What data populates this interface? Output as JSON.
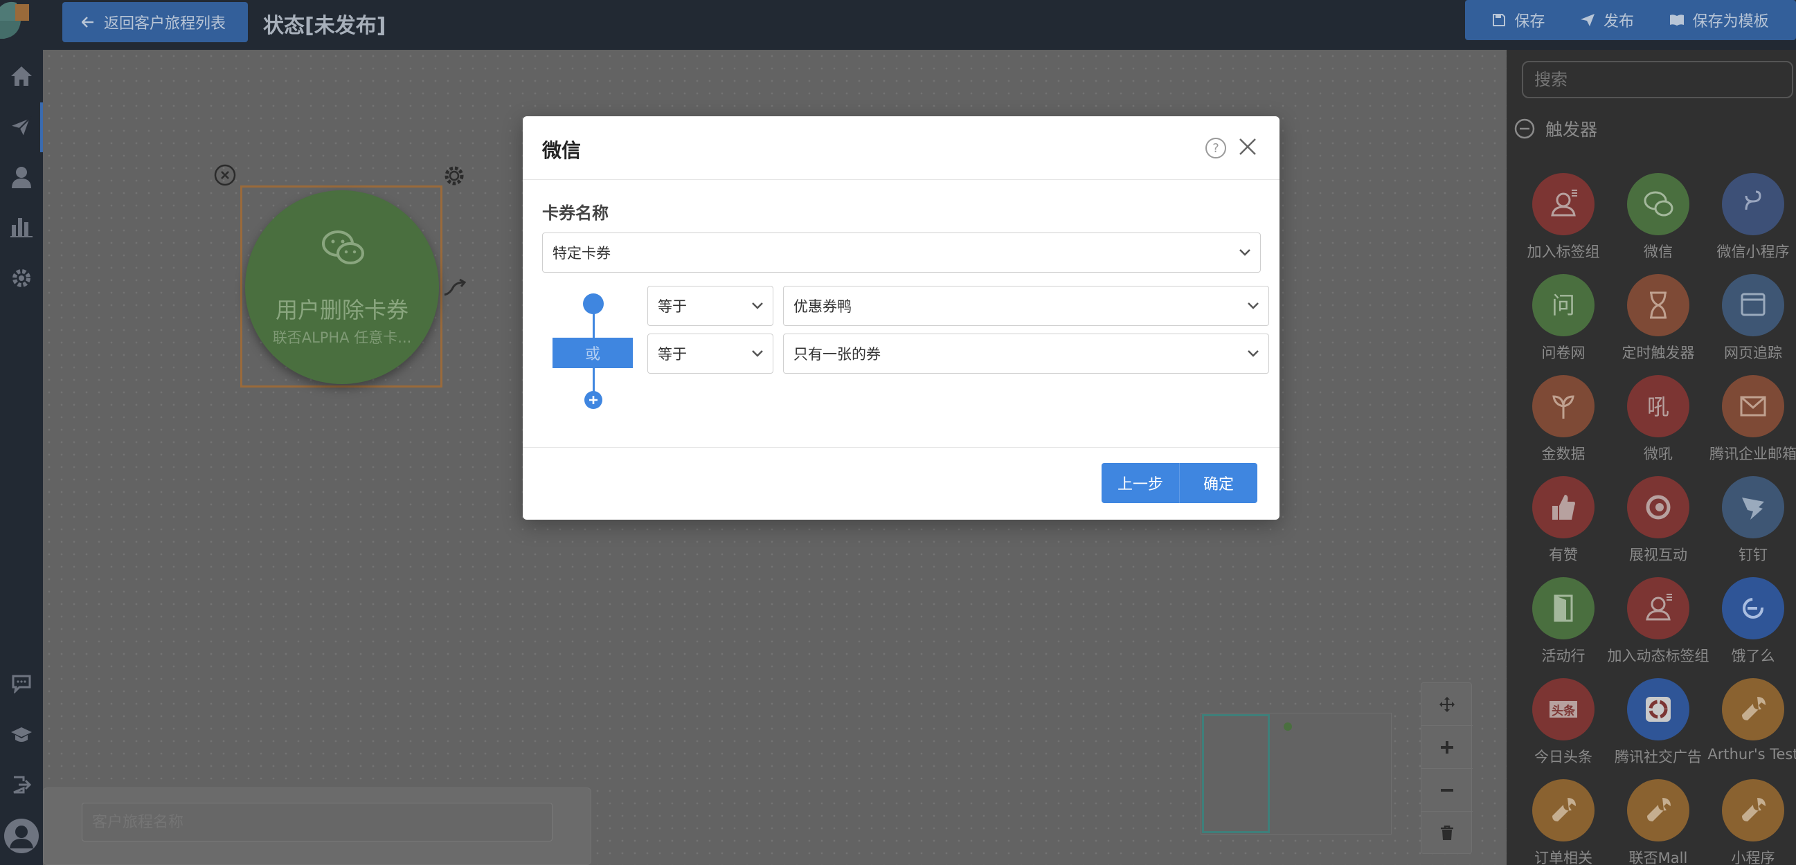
{
  "topbar": {
    "back_label": "返回客户旅程列表",
    "status_title": "状态[未发布]",
    "save_label": "保存",
    "publish_label": "发布",
    "save_template_label": "保存为模板"
  },
  "canvas": {
    "node_title": "用户删除卡券",
    "node_subtitle": "联否ALPHA 任意卡...",
    "journey_name_placeholder": "客户旅程名称"
  },
  "right_panel": {
    "search_placeholder": "搜索",
    "section_title": "触发器",
    "tiles": [
      {
        "label": "加入标签组",
        "color": "#7c3533",
        "icon": "user-tag-icon"
      },
      {
        "label": "微信",
        "color": "#4a6f3f",
        "icon": "wechat-icon"
      },
      {
        "label": "微信小程序",
        "color": "#3d5077",
        "icon": "mini-program-icon"
      },
      {
        "label": "问卷网",
        "color": "#4a6f3f",
        "icon": "wen-icon"
      },
      {
        "label": "定时触发器",
        "color": "#7e4a36",
        "icon": "hourglass-icon"
      },
      {
        "label": "网页追踪",
        "color": "#3e5674",
        "icon": "browser-icon"
      },
      {
        "label": "金数据",
        "color": "#7e4a36",
        "icon": "sprout-icon"
      },
      {
        "label": "微吼",
        "color": "#7c3533",
        "icon": "vhall-icon"
      },
      {
        "label": "腾讯企业邮箱",
        "color": "#7e4a36",
        "icon": "mail-icon"
      },
      {
        "label": "有赞",
        "color": "#7c3533",
        "icon": "thumbs-up-icon"
      },
      {
        "label": "展视互动",
        "color": "#7c3533",
        "icon": "swirl-icon"
      },
      {
        "label": "钉钉",
        "color": "#3e5674",
        "icon": "dingtalk-icon"
      },
      {
        "label": "活动行",
        "color": "#4a6f3f",
        "icon": "door-icon"
      },
      {
        "label": "加入动态标签组",
        "color": "#7c3533",
        "icon": "user-tag-icon"
      },
      {
        "label": "饿了么",
        "color": "#2f5597",
        "icon": "eleme-icon"
      },
      {
        "label": "今日头条",
        "color": "#7c3533",
        "icon": "toutiao-icon"
      },
      {
        "label": "腾讯社交广告",
        "color": "#2f5597",
        "icon": "tencent-ads-icon"
      },
      {
        "label": "Arthur's Test",
        "color": "#8a6230",
        "icon": "wrench-icon"
      },
      {
        "label": "订单相关",
        "color": "#8a6230",
        "icon": "wrench-icon"
      },
      {
        "label": "联否Mall",
        "color": "#8a6230",
        "icon": "wrench-icon"
      },
      {
        "label": "小程序",
        "color": "#8a6230",
        "icon": "wrench-icon"
      }
    ]
  },
  "modal": {
    "title": "微信",
    "field_label": "卡券名称",
    "card_select": "特定卡券",
    "or_label": "或",
    "conditions": [
      {
        "operator": "等于",
        "value": "优惠券鸭"
      },
      {
        "operator": "等于",
        "value": "只有一张的券"
      }
    ],
    "prev_label": "上一步",
    "confirm_label": "确定"
  },
  "colors": {
    "accent": "#3f86e0",
    "topbar_bg": "#222933",
    "node_green": "#4a6f3f"
  }
}
